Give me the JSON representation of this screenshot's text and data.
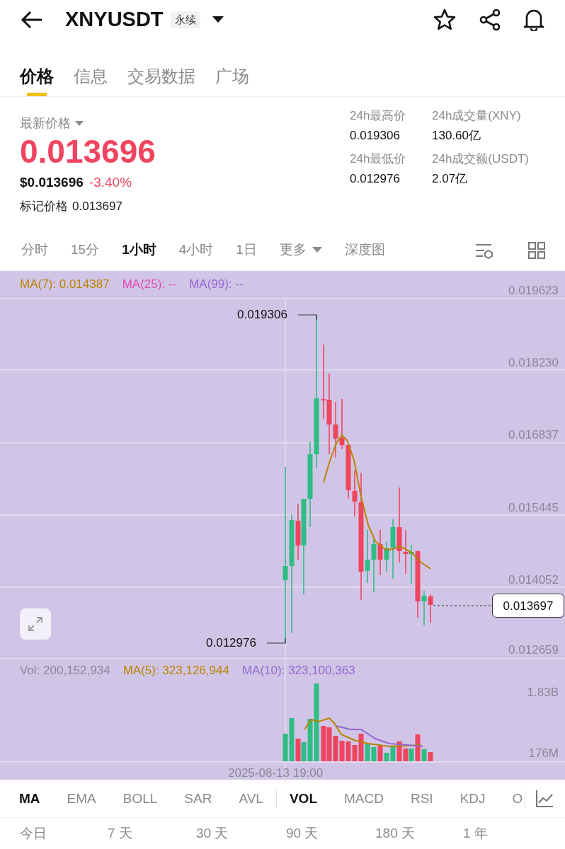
{
  "header": {
    "symbol": "XNYUSDT",
    "contract_type": "永续"
  },
  "tabs": [
    {
      "label": "价格",
      "selected": true
    },
    {
      "label": "信息",
      "selected": false
    },
    {
      "label": "交易数据",
      "selected": false
    },
    {
      "label": "广场",
      "selected": false
    }
  ],
  "price": {
    "label": "最新价格",
    "last": "0.013696",
    "usd": "$0.013696",
    "change": "-3.40%",
    "mark_label": "标记价格",
    "mark": "0.013697"
  },
  "stats": [
    {
      "label": "24h最高价",
      "value": "0.019306"
    },
    {
      "label": "24h成交量(XNY)",
      "value": "130.60亿"
    },
    {
      "label": "24h最低价",
      "value": "0.012976"
    },
    {
      "label": "24h成交额(USDT)",
      "value": "2.07亿"
    }
  ],
  "intervals": [
    {
      "label": "分时",
      "kind": "option",
      "selected": false
    },
    {
      "label": "15分",
      "kind": "option",
      "selected": false
    },
    {
      "label": "1小时",
      "kind": "option",
      "selected": true
    },
    {
      "label": "4小时",
      "kind": "option",
      "selected": false
    },
    {
      "label": "1日",
      "kind": "option",
      "selected": false
    },
    {
      "label": "更多",
      "kind": "dropdown",
      "selected": false
    },
    {
      "label": "深度图",
      "kind": "option",
      "selected": false
    }
  ],
  "chart": {
    "legend": [
      {
        "label": "MA(7): 0.014387",
        "color": "#b88400"
      },
      {
        "label": "MA(25): --",
        "color": "#e24ab4"
      },
      {
        "label": "MA(99): --",
        "color": "#9366cf"
      }
    ],
    "price_axis": [
      "0.019623",
      "0.018230",
      "0.016837",
      "0.015445",
      "0.014052",
      "0.012659"
    ],
    "high_label": "0.019306",
    "low_label": "0.012976",
    "current_price": "0.013697"
  },
  "volume": {
    "legend": [
      {
        "label": "Vol: 200,152,934",
        "color": "#8c8796"
      },
      {
        "label": "MA(5): 323,126,944",
        "color": "#b88400"
      },
      {
        "label": "MA(10): 323,100,363",
        "color": "#9366cf"
      }
    ],
    "axis": [
      "1.83B",
      "176M"
    ]
  },
  "time_label": "2025-08-13 19:00",
  "main_indicators": [
    {
      "label": "MA",
      "selected": true
    },
    {
      "label": "EMA",
      "selected": false
    },
    {
      "label": "BOLL",
      "selected": false
    },
    {
      "label": "SAR",
      "selected": false
    },
    {
      "label": "AVL",
      "selected": false
    }
  ],
  "sub_indicators": [
    {
      "label": "VOL",
      "selected": true
    },
    {
      "label": "MACD",
      "selected": false
    },
    {
      "label": "RSI",
      "selected": false
    },
    {
      "label": "KDJ",
      "selected": false
    },
    {
      "label": "O",
      "selected": false
    }
  ],
  "periods": [
    "今日",
    "7 天",
    "30 天",
    "90 天",
    "180 天",
    "1 年"
  ]
}
